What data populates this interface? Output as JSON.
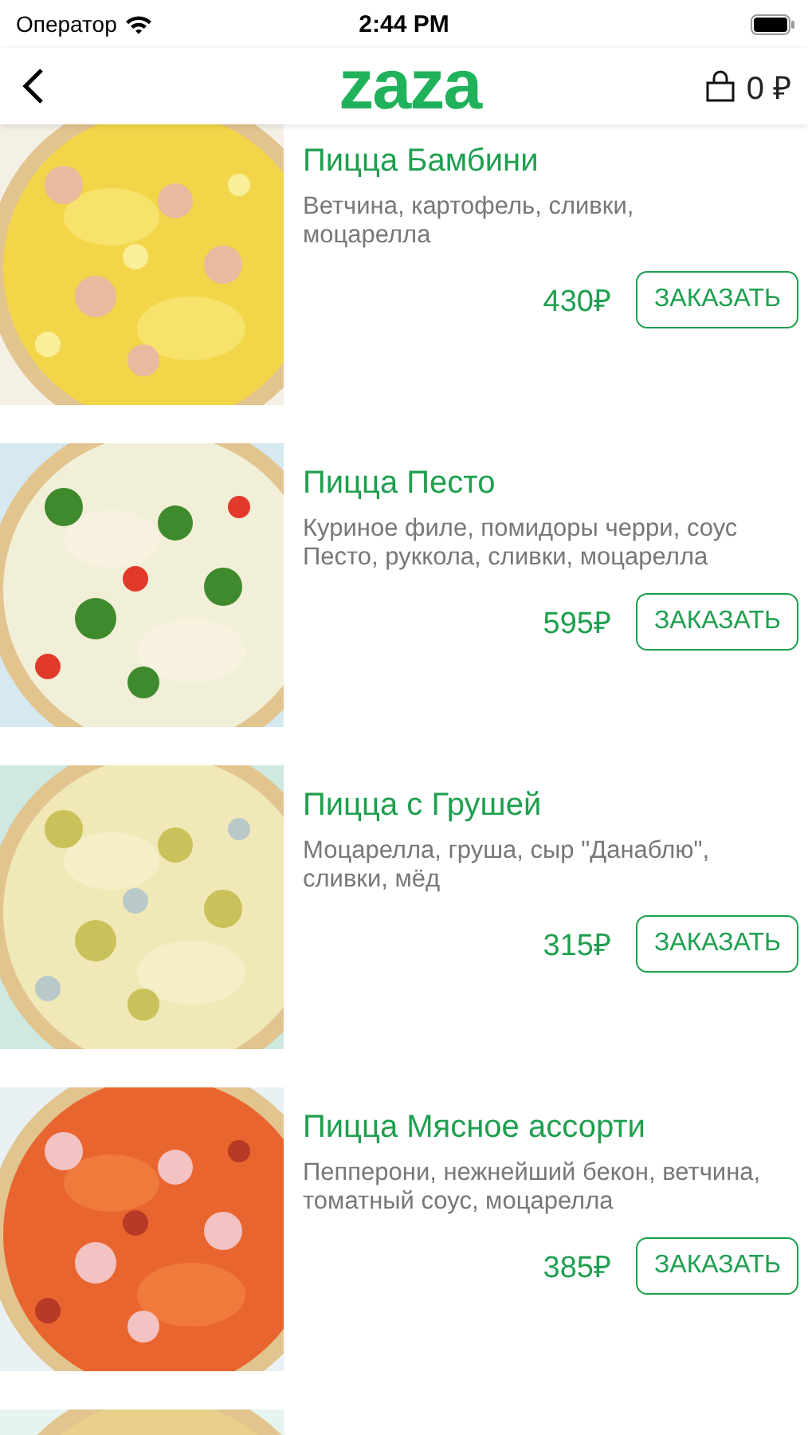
{
  "status_bar": {
    "carrier": "Оператор",
    "time": "2:44 PM"
  },
  "nav": {
    "logo": "zaza",
    "cart_total": "0 ₽"
  },
  "products": [
    {
      "kind": "product",
      "name": "Пицца Бамбини",
      "description": "Ветчина, картофель, сливки, моцарелла",
      "price": "430₽",
      "button": "ЗАКАЗАТЬ"
    },
    {
      "kind": "product",
      "name": "Пицца Песто",
      "description": "Куриное филе, помидоры черри, соус Песто, руккола, сливки, моцарелла",
      "price": "595₽",
      "button": "ЗАКАЗАТЬ"
    },
    {
      "kind": "product",
      "name": "Пицца с Грушей",
      "description": "Моцарелла, груша, сыр \"Данаблю\", сливки, мёд",
      "price": "315₽",
      "button": "ЗАКАЗАТЬ"
    },
    {
      "kind": "product",
      "name": "Пицца Мясное ассорти",
      "description": "Пепперони, нежнейший бекон, ветчина, томатный соус, моцарелла",
      "price": "385₽",
      "button": "ЗАКАЗАТЬ"
    },
    {
      "kind": "picture"
    }
  ]
}
